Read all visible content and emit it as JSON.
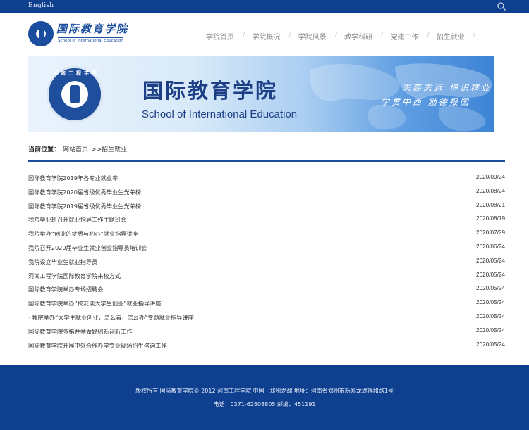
{
  "topbar": {
    "language_link": "English",
    "search_icon": "search-icon"
  },
  "header": {
    "logo_cn": "国际教育学院",
    "logo_en": "School of International Education",
    "nav": [
      {
        "label": "学院首页"
      },
      {
        "label": "学院概况"
      },
      {
        "label": "学院风景"
      },
      {
        "label": "教学科研"
      },
      {
        "label": "党建工作"
      },
      {
        "label": "招生就业"
      }
    ]
  },
  "banner": {
    "badge_text": "河南工程学院",
    "title_cn": "国际教育学院",
    "title_en": "School of International Education",
    "motto_line1": "志高志远 博识精业",
    "motto_line2": "学贯中西 励德报国"
  },
  "breadcrumb": {
    "label": "当前位置：",
    "home": "网站首页",
    "current": ">>招生就业"
  },
  "news": [
    {
      "title": "国际教育学院2019年各专业就业率",
      "date": "2020/09/24"
    },
    {
      "title": "国际教育学院2020届省级优秀毕业生光荣榜",
      "date": "2020/08/24"
    },
    {
      "title": "国际教育学院2019届省级优秀毕业生光荣榜",
      "date": "2020/08/21"
    },
    {
      "title": "我院毕业班召开就业指导工作主题班会",
      "date": "2020/08/19"
    },
    {
      "title": "我院举办“创业的梦想与初心”就业指导讲座",
      "date": "2020/07/29"
    },
    {
      "title": "我院召开2020届毕业生就业创业指导员培训会",
      "date": "2020/06/24"
    },
    {
      "title": "我院设立毕业生就业指导员",
      "date": "2020/05/24"
    },
    {
      "title": "河南工程学院国际教育学院来校方式",
      "date": "2020/05/24"
    },
    {
      "title": "国际教育学院举办专场招聘会",
      "date": "2020/05/24"
    },
    {
      "title": "国际教育学院举办“校友谈大学生创业”就业指导讲座",
      "date": "2020/05/24"
    },
    {
      "title": "· 我院举办“大学生就业创业，怎么看，怎么办”专题就业指导讲座",
      "date": "2020/05/24"
    },
    {
      "title": "国际教育学院多措并举做好招新迎新工作",
      "date": "2020/05/24"
    },
    {
      "title": "国际教育学院开展中外合作办学专业现场招生咨询工作",
      "date": "2020/05/24"
    }
  ],
  "footer": {
    "line1": "版权所有  国际教育学院© 2012  河南工程学院  中国  ·  郑州龙湖  地址：河南省郑州市新郑龙湖祥和路1号",
    "line2": "电话：0371-62508805  邮编：451191"
  },
  "colors": {
    "brand_blue": "#0f3f8f",
    "rule_blue": "#1d4e9c"
  }
}
